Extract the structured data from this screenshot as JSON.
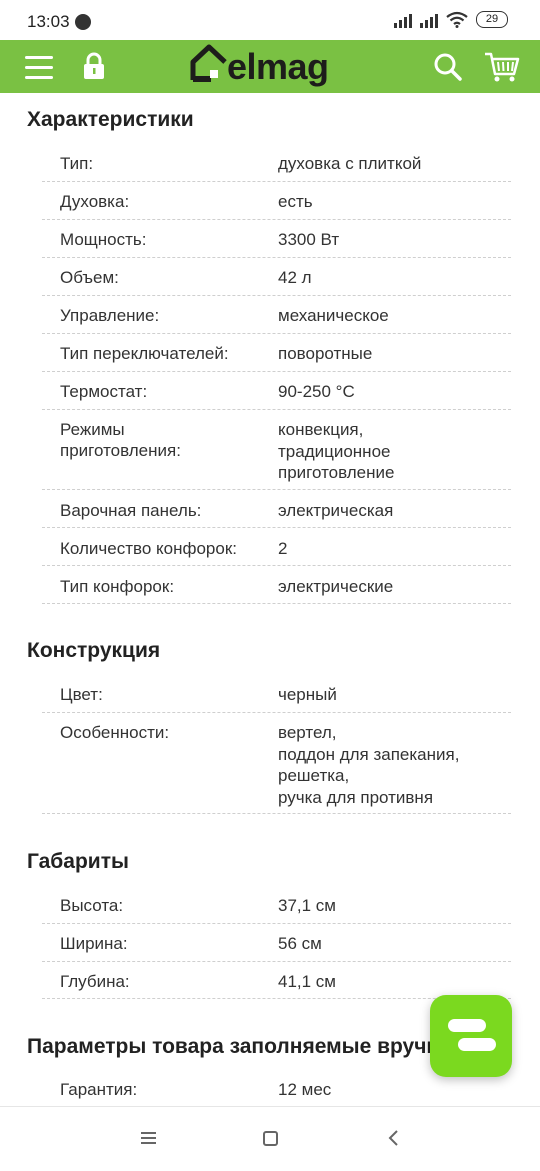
{
  "status_bar": {
    "time": "13:03",
    "battery": "29"
  },
  "header": {
    "logo_text": "elmag",
    "brand_color": "#7ac143"
  },
  "sections": [
    {
      "title": "Характеристики",
      "rows": [
        {
          "label": "Тип:",
          "value": "духовка с плиткой"
        },
        {
          "label": "Духовка:",
          "value": "есть"
        },
        {
          "label": "Мощность:",
          "value": "3300 Вт"
        },
        {
          "label": "Объем:",
          "value": "42 л"
        },
        {
          "label": "Управление:",
          "value": "механическое"
        },
        {
          "label": "Тип переключателей:",
          "value": "поворотные"
        },
        {
          "label": "Термостат:",
          "value": "90-250 °С"
        },
        {
          "label": "Режимы\nприготовления:",
          "value": "конвекция,\nтрадиционное\nприготовление"
        },
        {
          "label": "Варочная панель:",
          "value": "электрическая"
        },
        {
          "label": "Количество конфорок:",
          "value": "2"
        },
        {
          "label": "Тип конфорок:",
          "value": "электрические"
        }
      ]
    },
    {
      "title": "Конструкция",
      "rows": [
        {
          "label": "Цвет:",
          "value": "черный"
        },
        {
          "label": "Особенности:",
          "value": "вертел,\nподдон для запекания,\nрешетка,\nручка для противня"
        }
      ]
    },
    {
      "title": "Габариты",
      "rows": [
        {
          "label": "Высота:",
          "value": "37,1 см"
        },
        {
          "label": "Ширина:",
          "value": "56 см"
        },
        {
          "label": "Глубина:",
          "value": "41,1 см"
        }
      ]
    },
    {
      "title": "Параметры товара заполняемые вручную",
      "rows": [
        {
          "label": "Гарантия:",
          "value": "12 мес"
        }
      ]
    }
  ],
  "icons": {
    "menu": "hamburger-menu-icon",
    "lock": "lock-icon",
    "search": "search-icon",
    "cart": "cart-icon",
    "chat": "chat-icon"
  }
}
